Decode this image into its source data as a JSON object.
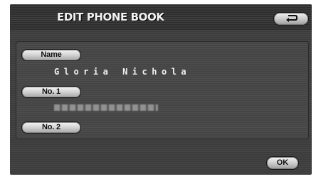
{
  "header": {
    "title": "EDIT PHONE BOOK",
    "back_icon": "return-arrow-icon"
  },
  "fields": {
    "name_label": "Name",
    "name_value": "Gloria Nichola",
    "no1_label": "No. 1",
    "no2_label": "No. 2"
  },
  "footer": {
    "ok_label": "OK"
  },
  "colors": {
    "screen_bg": "#3c3c3c",
    "button_face": "#d2d2d2",
    "text_light": "#f2f2f2"
  }
}
